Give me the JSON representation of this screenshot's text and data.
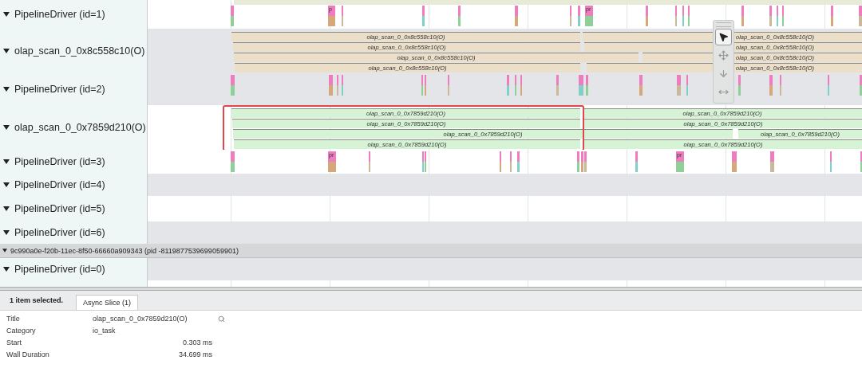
{
  "tracks": [
    {
      "kind": "driver",
      "label": "PipelineDriver (id=1)",
      "shaded": false,
      "top_bar": true,
      "slice_labels": [
        "p",
        "pr"
      ]
    },
    {
      "kind": "async",
      "label": "olap_scan_0_0x8c558c10(O)",
      "shaded": true,
      "color": "#ecdfca",
      "lanes": [
        {
          "segments": [
            "olap_scan_0_0x8c558c10(O)",
            "olap_scan_0_0x8c558c10(O)"
          ]
        },
        {
          "segments": [
            "olap_scan_0_0x8c558c10(O)",
            "olap_scan_0_0x8c558c10(O)"
          ]
        },
        {
          "segments": [
            "olap_scan_0_0x8c558c10(O)",
            "olap_scan_0_0x8c558c10(O)"
          ]
        },
        {
          "segments": [
            "olap_scan_0_0x8c558c10(O)",
            "olap_scan_0_0x8c558c10(O)"
          ]
        }
      ]
    },
    {
      "kind": "driver",
      "label": "PipelineDriver (id=2)",
      "shaded": true
    },
    {
      "kind": "async",
      "label": "olap_scan_0_0x7859d210(O)",
      "shaded": false,
      "color": "#d6f3d6",
      "highlighted": true,
      "lanes": [
        {
          "segments": [
            "olap_scan_0_0x7859d210(O)",
            "olap_scan_0_0x7859d210(O)"
          ]
        },
        {
          "segments": [
            "olap_scan_0_0x7859d210(O)",
            "olap_scan_0_0x7859d210(O)"
          ]
        },
        {
          "segments": [
            "olap_scan_0_0x7859d210(O)",
            "olap_scan_0_0x7859d210(O)"
          ]
        },
        {
          "segments": [
            "olap_scan_0_0x7859d210(O)",
            "olap_scan_0_0x7859d210(O)"
          ]
        }
      ]
    },
    {
      "kind": "driver",
      "label": "PipelineDriver (id=3)",
      "shaded": false,
      "slice_labels": [
        "pr",
        "pr"
      ]
    },
    {
      "kind": "driver",
      "label": "PipelineDriver (id=4)",
      "shaded": true
    },
    {
      "kind": "driver",
      "label": "PipelineDriver (id=5)",
      "shaded": false
    },
    {
      "kind": "driver",
      "label": "PipelineDriver (id=6)",
      "shaded": true
    },
    {
      "kind": "process",
      "label": "9c990a0e-f20b-11ec-8f50-66660a909343 (pid -8119877539699059901)"
    },
    {
      "kind": "driver",
      "label": "PipelineDriver (id=0)",
      "shaded": true
    },
    {
      "kind": "driver",
      "shaded": false
    }
  ],
  "tools": [
    {
      "selected": true
    },
    {
      "selected": false
    },
    {
      "selected": false
    },
    {
      "selected": false
    }
  ],
  "details": {
    "summary": "1 item selected.",
    "tabs": [
      {
        "label": "Async Slice (1)",
        "selected": true
      }
    ],
    "properties": [
      {
        "kind": "text",
        "name": "Title",
        "value": "olap_scan_0_0x7859d210(O)",
        "searchable": true
      },
      {
        "kind": "text",
        "name": "Category",
        "value": "io_task"
      },
      {
        "kind": "time",
        "name": "Start",
        "value": "0.303 ms"
      },
      {
        "kind": "time",
        "name": "Wall Duration",
        "value": "34.699 ms"
      }
    ]
  }
}
